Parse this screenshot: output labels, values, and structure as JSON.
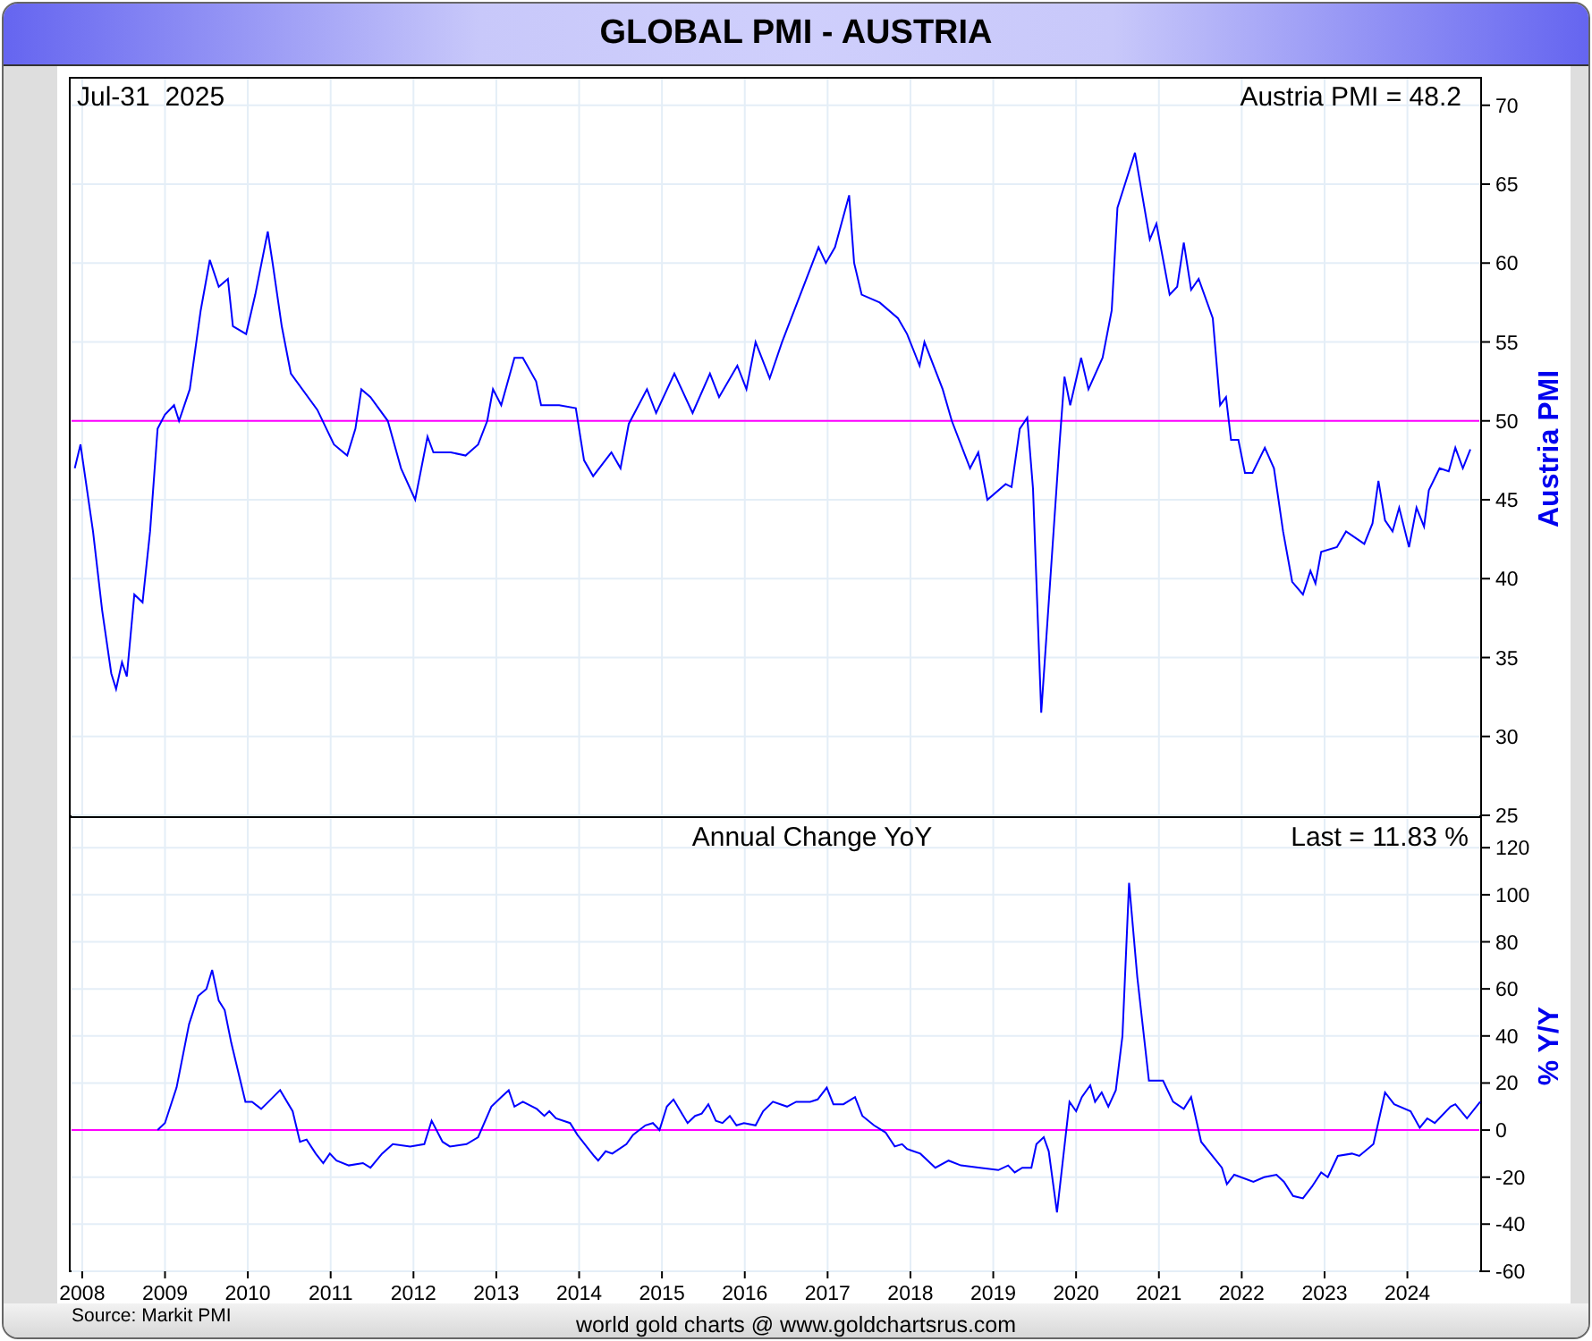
{
  "title": "GLOBAL PMI - AUSTRIA",
  "pmi_panel": {
    "date_label": "Jul-31  2025",
    "reading": "Austria PMI = 48.2",
    "chart_data": {
      "type": "line",
      "ylabel": "Austria PMI",
      "xlim": [
        2007.85,
        2024.89
      ],
      "ylim": [
        25,
        71.8
      ],
      "yticks": [
        25,
        30,
        35,
        40,
        45,
        50,
        55,
        60,
        65,
        70
      ],
      "grid": true,
      "ref_lines": [
        {
          "axis": "y",
          "value": 50,
          "color": "#ff00ff"
        }
      ],
      "x": [
        2007.91,
        2007.98,
        2008.13,
        2008.24,
        2008.35,
        2008.41,
        2008.48,
        2008.54,
        2008.63,
        2008.73,
        2008.82,
        2008.91,
        2009.0,
        2009.11,
        2009.17,
        2009.3,
        2009.43,
        2009.54,
        2009.65,
        2009.76,
        2009.82,
        2009.98,
        2010.09,
        2010.24,
        2010.3,
        2010.41,
        2010.52,
        2010.84,
        2011.04,
        2011.2,
        2011.3,
        2011.37,
        2011.48,
        2011.69,
        2011.85,
        2012.02,
        2012.17,
        2012.24,
        2012.45,
        2012.63,
        2012.78,
        2012.89,
        2012.96,
        2013.06,
        2013.22,
        2013.32,
        2013.48,
        2013.54,
        2013.76,
        2013.96,
        2014.06,
        2014.17,
        2014.39,
        2014.5,
        2014.6,
        2014.82,
        2014.93,
        2015.15,
        2015.37,
        2015.58,
        2015.69,
        2015.91,
        2016.02,
        2016.13,
        2016.3,
        2016.45,
        2016.67,
        2016.89,
        2016.98,
        2017.09,
        2017.26,
        2017.32,
        2017.41,
        2017.63,
        2017.85,
        2017.96,
        2018.11,
        2018.17,
        2018.39,
        2018.5,
        2018.72,
        2018.82,
        2018.93,
        2019.15,
        2019.22,
        2019.32,
        2019.41,
        2019.48,
        2019.58,
        2019.69,
        2019.8,
        2019.86,
        2019.93,
        2020.06,
        2020.15,
        2020.32,
        2020.43,
        2020.5,
        2020.71,
        2020.89,
        2020.97,
        2021.13,
        2021.22,
        2021.3,
        2021.39,
        2021.48,
        2021.65,
        2021.74,
        2021.81,
        2021.87,
        2021.96,
        2022.04,
        2022.13,
        2022.28,
        2022.39,
        2022.5,
        2022.61,
        2022.74,
        2022.83,
        2022.89,
        2022.96,
        2023.15,
        2023.26,
        2023.48,
        2023.58,
        2023.65,
        2023.73,
        2023.82,
        2023.9,
        2024.02,
        2024.11,
        2024.2,
        2024.26,
        2024.39,
        2024.5,
        2024.58,
        2024.67,
        2024.76
      ],
      "series": [
        {
          "color": "#0000ff",
          "values": [
            47,
            48.5,
            43,
            38,
            34,
            33,
            34.7,
            33.8,
            39,
            38.5,
            43,
            49.5,
            50.4,
            51,
            50,
            52,
            57,
            60.2,
            58.5,
            59,
            56,
            55.5,
            58,
            62,
            60,
            56,
            53,
            50.7,
            48.5,
            47.8,
            49.5,
            52,
            51.5,
            50,
            47,
            45,
            49,
            48,
            48,
            47.8,
            48.5,
            50,
            52,
            51,
            54,
            54,
            52.5,
            51,
            51,
            50.8,
            47.5,
            46.5,
            48,
            47,
            49.8,
            52,
            50.5,
            53,
            50.5,
            53,
            51.5,
            53.5,
            52,
            55,
            52.7,
            55,
            58,
            61,
            60,
            61,
            64.3,
            60,
            58,
            57.5,
            56.5,
            55.5,
            53.5,
            55,
            52,
            50,
            47,
            48,
            45,
            46,
            45.8,
            49.5,
            50.2,
            45.7,
            31.5,
            40,
            48.5,
            52.8,
            51,
            54,
            52,
            54,
            57,
            63.5,
            67,
            61.5,
            62.5,
            58,
            58.5,
            61.3,
            58.3,
            59,
            56.5,
            51,
            51.5,
            48.8,
            48.8,
            46.7,
            46.7,
            48.3,
            47,
            43,
            39.8,
            39,
            40.5,
            39.7,
            41.7,
            42,
            43,
            42.2,
            43.5,
            46.2,
            43.7,
            43,
            44.5,
            42,
            44.5,
            43.3,
            45.6,
            47,
            46.8,
            48.3,
            47,
            48.2
          ]
        }
      ]
    }
  },
  "yoy_panel": {
    "title": "Annual Change YoY",
    "reading": "Last = 11.83 %",
    "chart_data": {
      "type": "line",
      "ylabel": "% Y/Y",
      "xlim": [
        2007.85,
        2024.89
      ],
      "ylim": [
        -60,
        133
      ],
      "yticks": [
        -60,
        -40,
        -20,
        0,
        20,
        40,
        60,
        80,
        100,
        120
      ],
      "xticks": [
        2008,
        2009,
        2010,
        2011,
        2012,
        2013,
        2014,
        2015,
        2016,
        2017,
        2018,
        2019,
        2020,
        2021,
        2022,
        2023,
        2024
      ],
      "grid": true,
      "ref_lines": [
        {
          "axis": "y",
          "value": 0,
          "color": "#ff00ff"
        }
      ],
      "x": [
        2008.91,
        2009.0,
        2009.14,
        2009.29,
        2009.4,
        2009.5,
        2009.57,
        2009.65,
        2009.72,
        2009.8,
        2009.97,
        2010.05,
        2010.16,
        2010.25,
        2010.39,
        2010.54,
        2010.63,
        2010.71,
        2010.82,
        2010.91,
        2010.99,
        2011.07,
        2011.22,
        2011.39,
        2011.48,
        2011.62,
        2011.75,
        2011.96,
        2012.13,
        2012.22,
        2012.35,
        2012.44,
        2012.64,
        2012.78,
        2012.94,
        2013.06,
        2013.15,
        2013.22,
        2013.32,
        2013.49,
        2013.58,
        2013.64,
        2013.72,
        2013.89,
        2013.98,
        2014.18,
        2014.23,
        2014.32,
        2014.4,
        2014.57,
        2014.65,
        2014.8,
        2014.89,
        2014.97,
        2015.06,
        2015.14,
        2015.31,
        2015.4,
        2015.48,
        2015.56,
        2015.65,
        2015.73,
        2015.82,
        2015.9,
        2015.99,
        2016.13,
        2016.22,
        2016.34,
        2016.51,
        2016.62,
        2016.79,
        2016.88,
        2016.99,
        2017.07,
        2017.19,
        2017.33,
        2017.42,
        2017.56,
        2017.7,
        2017.81,
        2017.9,
        2017.96,
        2018.12,
        2018.3,
        2018.46,
        2018.61,
        2018.84,
        2019.06,
        2019.18,
        2019.26,
        2019.35,
        2019.46,
        2019.52,
        2019.61,
        2019.67,
        2019.77,
        2019.92,
        2020.0,
        2020.07,
        2020.17,
        2020.23,
        2020.31,
        2020.39,
        2020.48,
        2020.56,
        2020.64,
        2020.74,
        2020.88,
        2021.05,
        2021.17,
        2021.3,
        2021.39,
        2021.51,
        2021.76,
        2021.82,
        2021.91,
        2022.14,
        2022.27,
        2022.42,
        2022.51,
        2022.62,
        2022.74,
        2022.85,
        2022.96,
        2023.04,
        2023.16,
        2023.33,
        2023.42,
        2023.59,
        2023.73,
        2023.84,
        2024.04,
        2024.15,
        2024.24,
        2024.33,
        2024.52,
        2024.58,
        2024.72,
        2024.88
      ],
      "series": [
        {
          "color": "#0000ff",
          "values": [
            0,
            3,
            18,
            45,
            57,
            60,
            68,
            55,
            51,
            37,
            12,
            12,
            9,
            12,
            17,
            8,
            -5,
            -4,
            -10,
            -14,
            -10,
            -13,
            -15,
            -14,
            -16,
            -10,
            -6,
            -7,
            -6,
            4,
            -5,
            -7,
            -6,
            -3,
            10,
            14,
            17,
            10,
            12,
            9,
            6,
            8,
            5,
            3,
            -2,
            -11,
            -13,
            -9,
            -10,
            -6,
            -2,
            2,
            3,
            0,
            10,
            13,
            3,
            6,
            7,
            11,
            4,
            3,
            6,
            2,
            3,
            2,
            8,
            12,
            10,
            12,
            12,
            13,
            18,
            11,
            11,
            14,
            6,
            2,
            -1,
            -7,
            -6,
            -8,
            -10,
            -16,
            -13,
            -15,
            -16,
            -17,
            -15,
            -18,
            -16,
            -16,
            -6,
            -3,
            -9,
            -35,
            12,
            8,
            14,
            19,
            12,
            16,
            10,
            17,
            40,
            105,
            65,
            21,
            21,
            12,
            9,
            14,
            -5,
            -16,
            -23,
            -19,
            -22,
            -20,
            -19,
            -22,
            -28,
            -29,
            -24,
            -18,
            -20,
            -11,
            -10,
            -11,
            -6,
            16,
            11,
            8,
            1,
            5,
            3,
            10,
            11,
            5,
            12
          ]
        }
      ]
    }
  },
  "source": "Source: Markit PMI",
  "credit": "world gold charts @ www.goldchartsrus.com"
}
